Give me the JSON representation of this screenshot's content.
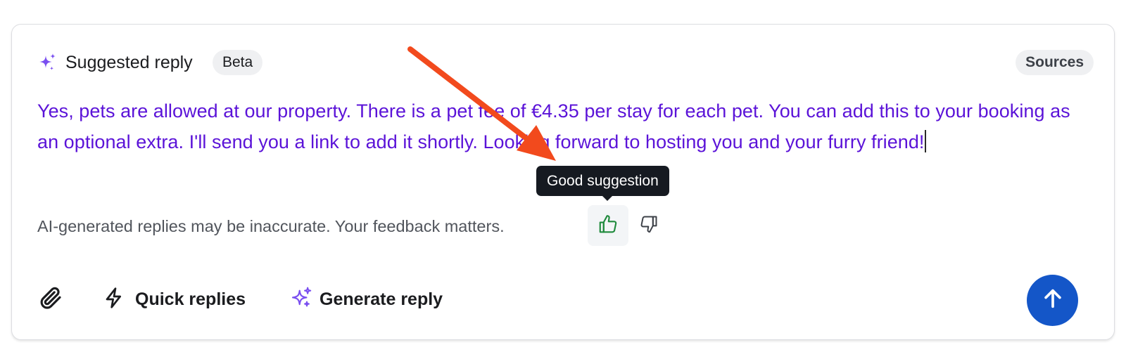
{
  "header": {
    "title": "Suggested reply",
    "badge": "Beta",
    "sources_label": "Sources",
    "icon": "sparkle-icon"
  },
  "reply": {
    "text": "Yes, pets are allowed at our property. There is a pet fee of €4.35 per stay for each pet. You can add this to your booking as an optional extra. I'll send you a link to add it shortly. Looking forward to hosting you and your furry friend!"
  },
  "feedback": {
    "disclaimer": "AI-generated replies may be inaccurate. Your feedback matters.",
    "tooltip": "Good suggestion",
    "thumb_up_icon": "thumbs-up-icon",
    "thumb_down_icon": "thumbs-down-icon"
  },
  "footer": {
    "attach_icon": "paperclip-icon",
    "quick_replies_label": "Quick replies",
    "quick_replies_icon": "lightning-icon",
    "generate_reply_label": "Generate reply",
    "generate_reply_icon": "sparkle-icon",
    "send_icon": "arrow-up-icon"
  },
  "colors": {
    "reply_text": "#5b13d8",
    "sparkle": "#7a4ff0",
    "thumb_up": "#1f8a3c",
    "send_button": "#1456c8",
    "tooltip_bg": "#161a21",
    "annotation_arrow": "#f24a1d"
  }
}
